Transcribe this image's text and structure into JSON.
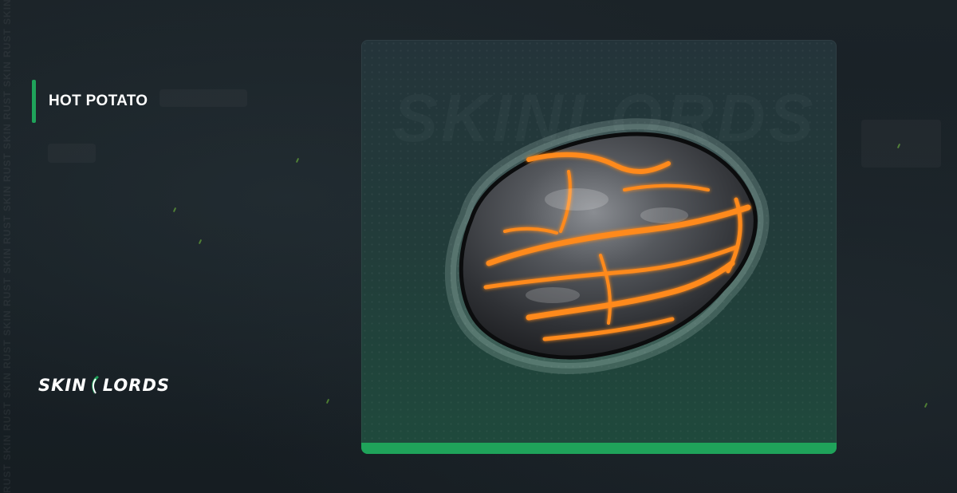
{
  "item": {
    "title": "HOT POTATO",
    "image_icon": "hot-potato-rock-icon"
  },
  "brand": {
    "logo_left": "SKIN",
    "logo_right": "LORDS",
    "side_watermark": "RUST SKIN RUST SKIN RUST SKIN RUST SKIN RUST SKIN RUST SKIN RUST SKIN RUST SKIN RUST SKIN RUST SKIN",
    "card_watermark": "SKINLORDS"
  },
  "colors": {
    "accent_green": "#1fa35a",
    "background": "#182025",
    "lava_orange": "#ff8a1a",
    "rock_gray": "#4a4d52"
  }
}
